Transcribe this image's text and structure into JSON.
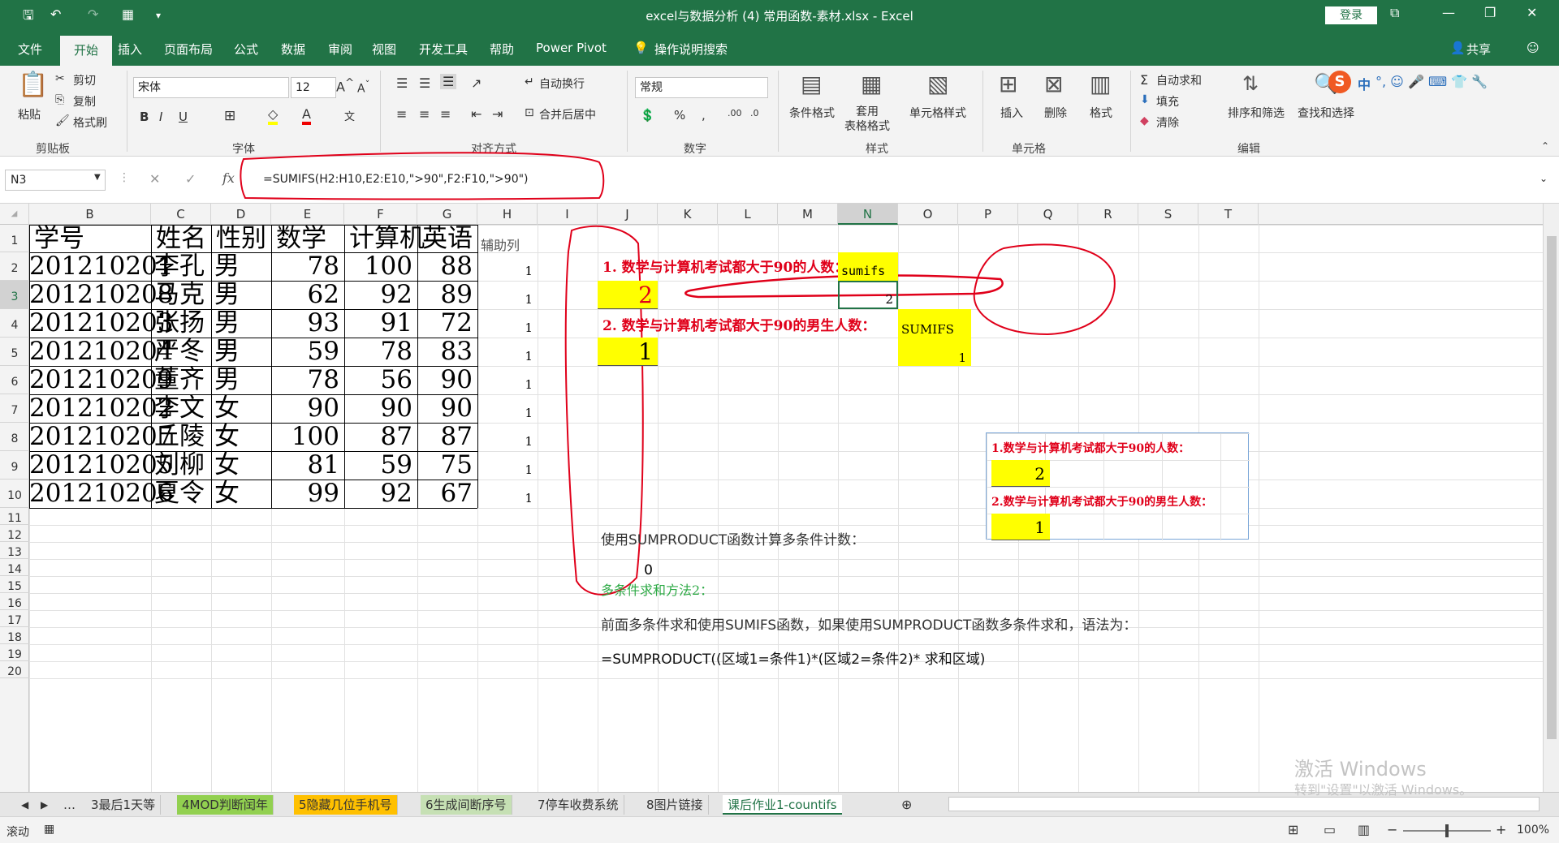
{
  "window": {
    "title": "excel与数据分析 (4) 常用函数-素材.xlsx  -  Excel",
    "login": "登录"
  },
  "tabs": [
    "文件",
    "开始",
    "插入",
    "页面布局",
    "公式",
    "数据",
    "审阅",
    "视图",
    "开发工具",
    "帮助",
    "Power Pivot",
    "操作说明搜索"
  ],
  "share": "共享",
  "ribbon": {
    "paste": "粘贴",
    "cut": "剪切",
    "copy": "复制",
    "format_painter": "格式刷",
    "clipboard": "剪贴板",
    "font_name": "宋体",
    "font_size": "12",
    "font_group": "字体",
    "wrap": "自动换行",
    "merge": "合并后居中",
    "align_group": "对齐方式",
    "number_format": "常规",
    "number_group": "数字",
    "cond_format": "条件格式",
    "table_format": "套用\n表格格式",
    "cell_style": "单元格样式",
    "styles_group": "样式",
    "insert": "插入",
    "delete": "删除",
    "format": "格式",
    "cells_group": "单元格",
    "autosum": "自动求和",
    "fill": "填充",
    "clear": "清除",
    "sort_filter": "排序和筛选",
    "find_select": "查找和选择",
    "edit_group": "编辑",
    "ime": "中"
  },
  "formula_bar": {
    "name_box": "N3",
    "formula": "=SUMIFS(H2:H10,E2:E10,\">90\",F2:F10,\">90\")",
    "fx": "fx"
  },
  "columns": [
    "B",
    "C",
    "D",
    "E",
    "F",
    "G",
    "H",
    "I",
    "J",
    "K",
    "L",
    "M",
    "N",
    "O",
    "P",
    "Q",
    "R",
    "S",
    "T"
  ],
  "rows": [
    "1",
    "2",
    "3",
    "4",
    "5",
    "6",
    "7",
    "8",
    "9",
    "10",
    "11",
    "12",
    "13",
    "14",
    "15",
    "16",
    "17",
    "18",
    "19",
    "20"
  ],
  "table": {
    "headers": [
      "学号",
      "姓名",
      "性别",
      "数学",
      "计算机",
      "英语"
    ],
    "rows": [
      [
        "201210201",
        "李孔",
        "男",
        "78",
        "100",
        "88"
      ],
      [
        "201210208",
        "马克",
        "男",
        "62",
        "92",
        "89"
      ],
      [
        "201210203",
        "张扬",
        "男",
        "93",
        "91",
        "72"
      ],
      [
        "201210204",
        "严冬",
        "男",
        "59",
        "78",
        "83"
      ],
      [
        "201210209",
        "董齐",
        "男",
        "78",
        "56",
        "90"
      ],
      [
        "201210202",
        "李文",
        "女",
        "90",
        "90",
        "90"
      ],
      [
        "201210207",
        "丘陵",
        "女",
        "100",
        "87",
        "87"
      ],
      [
        "201210205",
        "刘柳",
        "女",
        "81",
        "59",
        "75"
      ],
      [
        "201210206",
        "夏令",
        "女",
        "99",
        "92",
        "67"
      ]
    ],
    "helper_header": "辅助列",
    "helper_values": [
      "1",
      "1",
      "1",
      "1",
      "1",
      "1",
      "1",
      "1",
      "1"
    ]
  },
  "right": {
    "q1": "1. 数学与计算机考试都大于90的人数：",
    "q1_ans": "2",
    "n2": "sumifs",
    "n3": "2",
    "q2": "2. 数学与计算机考试都大于90的男生人数：",
    "q2_ans": "1",
    "o4": "SUMIFS",
    "o5": "1",
    "box_q1": "1.数学与计算机考试都大于90的人数：",
    "box_a1": "2",
    "box_q2": "2.数学与计算机考试都大于90的男生人数：",
    "box_a2": "1",
    "r12": "使用SUMPRODUCT函数计算多条件计数：",
    "r14": "0",
    "r15": "多条件求和方法2：",
    "r17": "前面多条件求和使用SUMIFS函数，如果使用SUMPRODUCT函数多条件求和，语法为：",
    "r19": "=SUMPRODUCT((区域1=条件1)*(区域2=条件2)* 求和区域)"
  },
  "sheet_tabs": [
    {
      "label": "3最后1天等",
      "color": "#e6e6e6"
    },
    {
      "label": "4MOD判断闰年",
      "color": "#92d050"
    },
    {
      "label": "5隐藏几位手机号",
      "color": "#ffc000"
    },
    {
      "label": "6生成间断序号",
      "color": "#c6e0b4"
    },
    {
      "label": "7停车收费系统",
      "color": "#e6e6e6"
    },
    {
      "label": "8图片链接",
      "color": "#e6e6e6"
    },
    {
      "label": "课后作业1-countifs",
      "color": "#ffffff"
    }
  ],
  "status": {
    "mode": "滚动",
    "zoom": "100%"
  },
  "watermark": {
    "line1": "激活 Windows",
    "line2": "转到\"设置\"以激活 Windows。"
  }
}
